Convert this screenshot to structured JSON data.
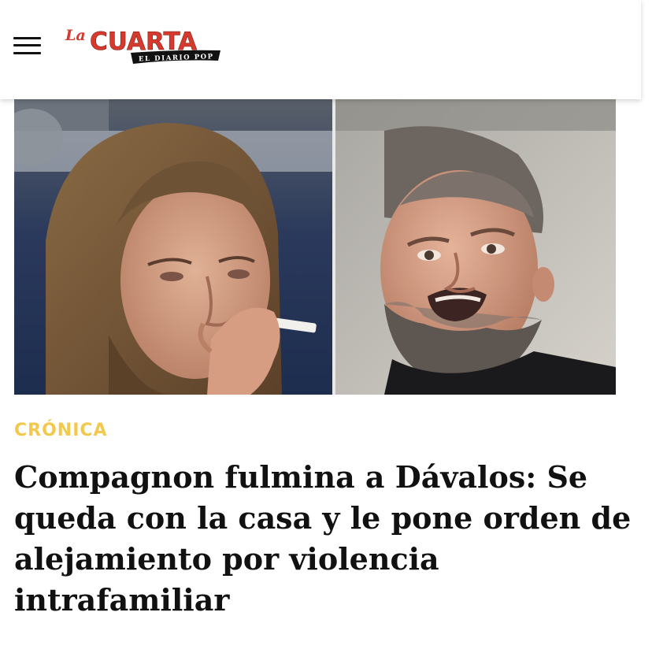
{
  "header": {
    "menu_icon": "hamburger-menu-icon",
    "logo": {
      "prefix": "La",
      "name": "CUARTA",
      "tagline": "EL DIARIO POP",
      "colors": {
        "red": "#d63a2e",
        "banner": "#111111",
        "banner_text": "#ffffff"
      }
    }
  },
  "article": {
    "section": "CRÓNICA",
    "section_color": "#f2c94c",
    "headline": "Compagnon fulmina a Dávalos: Se queda con la casa y le pone orden de alejamiento por violencia intrafamiliar",
    "image": "two-portrait-photo-collage"
  }
}
